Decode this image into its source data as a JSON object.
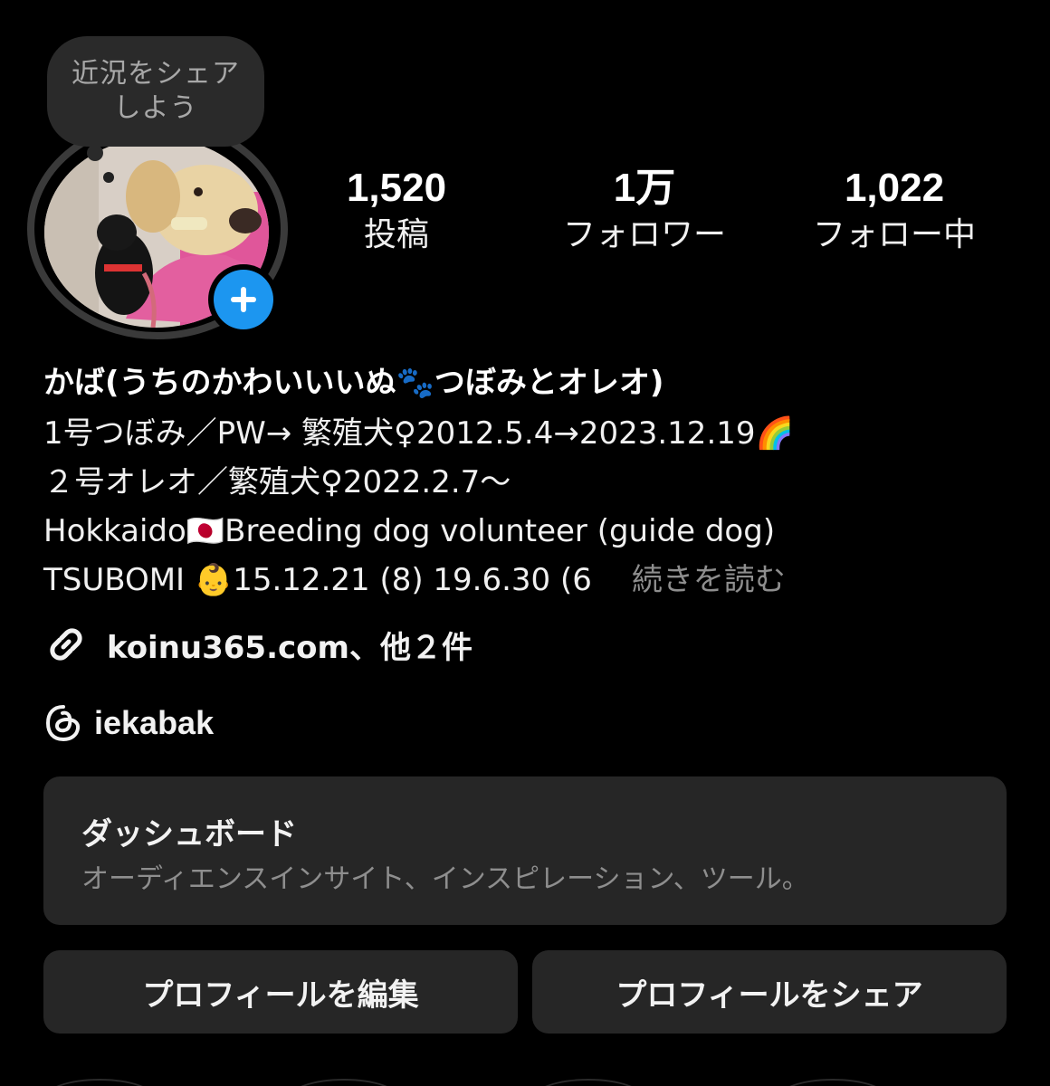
{
  "note": {
    "text": "近況をシェアしよう"
  },
  "stats": [
    {
      "value": "1,520",
      "label": "投稿"
    },
    {
      "value": "1万",
      "label": "フォロワー"
    },
    {
      "value": "1,022",
      "label": "フォロー中"
    }
  ],
  "profile": {
    "name": "かば(うちのかわいいいぬ🐾つぼみとオレオ)",
    "bio_lines": [
      "1号つぼみ／PW→ 繁殖犬♀2012.5.4→2023.12.19🌈",
      "２号オレオ／繁殖犬♀2022.2.7～",
      "Hokkaido🇯🇵Breeding dog volunteer (guide dog)",
      "TSUBOMI 👶15.12.21 (8) 19.6.30 (6"
    ],
    "more_label": "続きを読む",
    "link_text": "koinu365.com、他２件",
    "threads_handle": "iekabak"
  },
  "dashboard": {
    "title": "ダッシュボード",
    "subtitle": "オーディエンスインサイト、インスピレーション、ツール。"
  },
  "buttons": {
    "edit_profile": "プロフィールを編集",
    "share_profile": "プロフィールをシェア"
  },
  "colors": {
    "background": "#000000",
    "card": "#262626",
    "accent_blue": "#1c96f0",
    "muted_text": "#8e8e8e"
  }
}
